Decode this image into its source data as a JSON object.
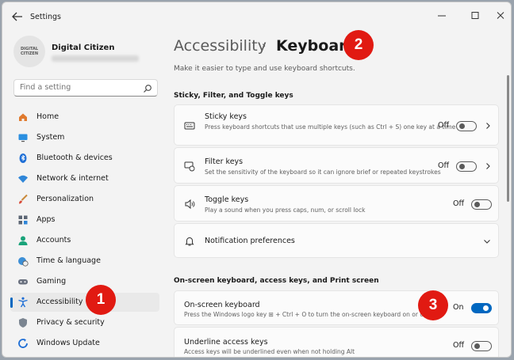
{
  "titlebar": {
    "app_title": "Settings"
  },
  "profile": {
    "name": "Digital Citizen",
    "avatar_text": "DIGITAL CITIZEN"
  },
  "search": {
    "placeholder": "Find a setting"
  },
  "nav": [
    {
      "label": "Home",
      "icon": "home-icon"
    },
    {
      "label": "System",
      "icon": "monitor-icon"
    },
    {
      "label": "Bluetooth & devices",
      "icon": "bluetooth-icon"
    },
    {
      "label": "Network & internet",
      "icon": "wifi-icon"
    },
    {
      "label": "Personalization",
      "icon": "brush-icon"
    },
    {
      "label": "Apps",
      "icon": "apps-icon"
    },
    {
      "label": "Accounts",
      "icon": "person-icon"
    },
    {
      "label": "Time & language",
      "icon": "globe-clock-icon"
    },
    {
      "label": "Gaming",
      "icon": "gamepad-icon"
    },
    {
      "label": "Accessibility",
      "icon": "accessibility-icon",
      "active": true
    },
    {
      "label": "Privacy & security",
      "icon": "shield-icon"
    },
    {
      "label": "Windows Update",
      "icon": "update-icon"
    }
  ],
  "breadcrumb": {
    "parent": "Accessibility",
    "separator": "›",
    "current": "Keyboard"
  },
  "subtitle": "Make it easier to type and use keyboard shortcuts.",
  "sections": {
    "sticky": "Sticky, Filter, and Toggle keys",
    "onscreen": "On-screen keyboard, access keys, and Print screen"
  },
  "cards": {
    "sticky": {
      "title": "Sticky keys",
      "desc": "Press keyboard shortcuts that use multiple keys (such as Ctrl + S) one key at a time",
      "state": "Off"
    },
    "filter": {
      "title": "Filter keys",
      "desc": "Set the sensitivity of the keyboard so it can ignore brief or repeated keystrokes",
      "state": "Off"
    },
    "toggle": {
      "title": "Toggle keys",
      "desc": "Play a sound when you press caps, num, or scroll lock",
      "state": "Off"
    },
    "notif": {
      "title": "Notification preferences"
    },
    "osk": {
      "title": "On-screen keyboard",
      "desc": "Press the Windows logo key ⊞ + Ctrl + O to turn the on-screen keyboard on or off",
      "state": "On"
    },
    "underline": {
      "title": "Underline access keys",
      "desc": "Access keys will be underlined even when not holding Alt",
      "state": "Off"
    }
  },
  "callouts": {
    "one": "1",
    "two": "2",
    "three": "3"
  },
  "colors": {
    "accent": "#0067c0",
    "callout": "#e11a12"
  }
}
